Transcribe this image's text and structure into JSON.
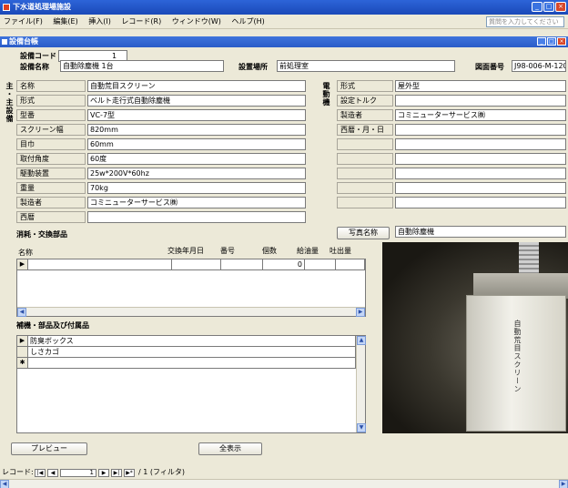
{
  "window": {
    "title": "下水道処理場施設"
  },
  "menu": [
    "ファイル(F)",
    "編集(E)",
    "挿入(I)",
    "レコード(R)",
    "ウィンドウ(W)",
    "ヘルプ(H)"
  ],
  "help_placeholder": "質問を入力してください",
  "form": {
    "title": "設備台帳",
    "code_label": "設備コード",
    "code_value": "1",
    "name_label": "設備名称",
    "name_value": "自動除塵機 1台",
    "location_label": "設置場所",
    "location_value": "前処理室",
    "drawing_label": "図面番号",
    "drawing_value": "J98-006-M-120",
    "main_section_label": "主設備・主設備",
    "main_vertical": [
      "主",
      "・",
      "主",
      "設",
      "備"
    ],
    "motor_vertical": [
      "電",
      "動",
      "機"
    ],
    "main_rows": [
      {
        "label": "名称",
        "value": "自動荒目スクリーン"
      },
      {
        "label": "形式",
        "value": "ベルト走行式自動除塵機"
      },
      {
        "label": "型番",
        "value": "VC-7型"
      },
      {
        "label": "スクリーン幅",
        "value": "820mm"
      },
      {
        "label": "目巾",
        "value": "60mm"
      },
      {
        "label": "取付角度",
        "value": "60度"
      },
      {
        "label": "駆動装置",
        "value": "25w*200V*60hz"
      },
      {
        "label": "重量",
        "value": "70kg"
      },
      {
        "label": "製造者",
        "value": "コミニューターサービス㈱"
      },
      {
        "label": "西暦",
        "value": ""
      }
    ],
    "motor_rows": [
      {
        "label": "形式",
        "value": "屋外型"
      },
      {
        "label": "設定トルク",
        "value": ""
      },
      {
        "label": "製造者",
        "value": "コミニューターサービス㈱"
      },
      {
        "label": "西暦・月・日",
        "value": ""
      },
      {
        "label": "",
        "value": ""
      },
      {
        "label": "",
        "value": ""
      },
      {
        "label": "",
        "value": ""
      },
      {
        "label": "",
        "value": ""
      },
      {
        "label": "",
        "value": ""
      }
    ],
    "photo_label": "写真名称",
    "photo_value": "自動除塵機",
    "photo_machine_text": "自動荒目スクリーン",
    "consumables_title": "消耗・交換部品",
    "consumables_columns": [
      "名称",
      "交換年月日",
      "番号",
      "個数",
      "給油量",
      "吐出量"
    ],
    "consumables_rows": [
      {
        "selector": "▶",
        "count": "0"
      }
    ],
    "parts_title": "補機・部品及び付属品",
    "parts_rows": [
      {
        "selector": "▶",
        "value": "防臭ボックス"
      },
      {
        "selector": "",
        "value": "しさカゴ"
      },
      {
        "selector": "✱",
        "value": ""
      }
    ],
    "preview_button": "プレビュー",
    "show_all_button": "全表示"
  },
  "navigation": {
    "label": "レコード:",
    "current": "1",
    "total_text": "/ 1 (フィルタ)"
  }
}
